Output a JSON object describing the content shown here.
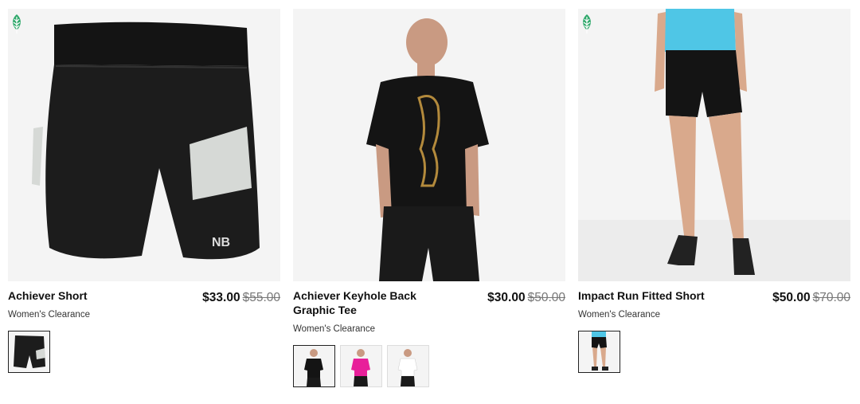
{
  "colors": {
    "eco_green": "#2ea86a",
    "text": "#111111",
    "strike": "#777777"
  },
  "products": [
    {
      "name": "Achiever Short",
      "sale_price": "$33.00",
      "original_price": "$55.00",
      "category": "Women's Clearance",
      "eco_badge": "leaf-icon",
      "swatches": [
        "black"
      ]
    },
    {
      "name": "Achiever Keyhole Back Graphic Tee",
      "sale_price": "$30.00",
      "original_price": "$50.00",
      "category": "Women's Clearance",
      "swatches": [
        "black",
        "pink",
        "white"
      ]
    },
    {
      "name": "Impact Run Fitted Short",
      "sale_price": "$50.00",
      "original_price": "$70.00",
      "category": "Women's Clearance",
      "eco_badge": "leaf-icon",
      "swatches": [
        "black"
      ]
    }
  ]
}
